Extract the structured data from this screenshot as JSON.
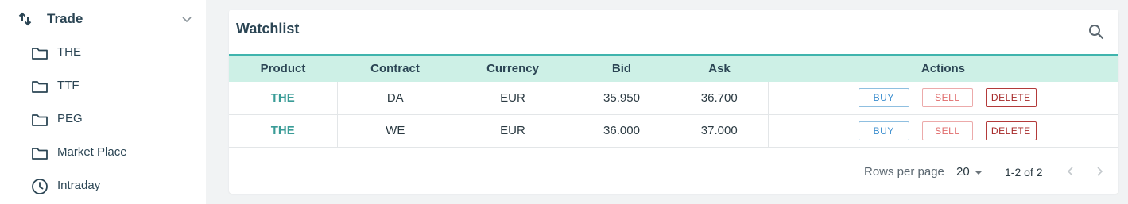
{
  "sidebar": {
    "section_label": "Trade",
    "section_icon": "swap-vertical-icon",
    "items": [
      {
        "label": "THE",
        "icon": "folder-icon"
      },
      {
        "label": "TTF",
        "icon": "folder-icon"
      },
      {
        "label": "PEG",
        "icon": "folder-icon"
      },
      {
        "label": "Market Place",
        "icon": "folder-icon"
      },
      {
        "label": "Intraday",
        "icon": "clock-icon"
      }
    ]
  },
  "watchlist": {
    "title": "Watchlist",
    "search_icon": "search-icon",
    "columns": [
      "Product",
      "Contract",
      "Currency",
      "Bid",
      "Ask",
      "Actions"
    ],
    "rows": [
      {
        "product": "THE",
        "contract": "DA",
        "currency": "EUR",
        "bid": "35.950",
        "ask": "36.700"
      },
      {
        "product": "THE",
        "contract": "WE",
        "currency": "EUR",
        "bid": "36.000",
        "ask": "37.000"
      }
    ],
    "actions": {
      "buy": "BUY",
      "sell": "SELL",
      "delete": "DELETE"
    },
    "footer": {
      "rows_per_page_label": "Rows per page",
      "rows_per_page_value": "20",
      "range": "1-2 of 2"
    }
  },
  "colors": {
    "header_bg": "#cdf0e6",
    "header_border": "#3fb4ad",
    "product_text": "#3a9c97",
    "buy": "#3d8fcf",
    "sell": "#e06b6b",
    "delete": "#a62828"
  }
}
